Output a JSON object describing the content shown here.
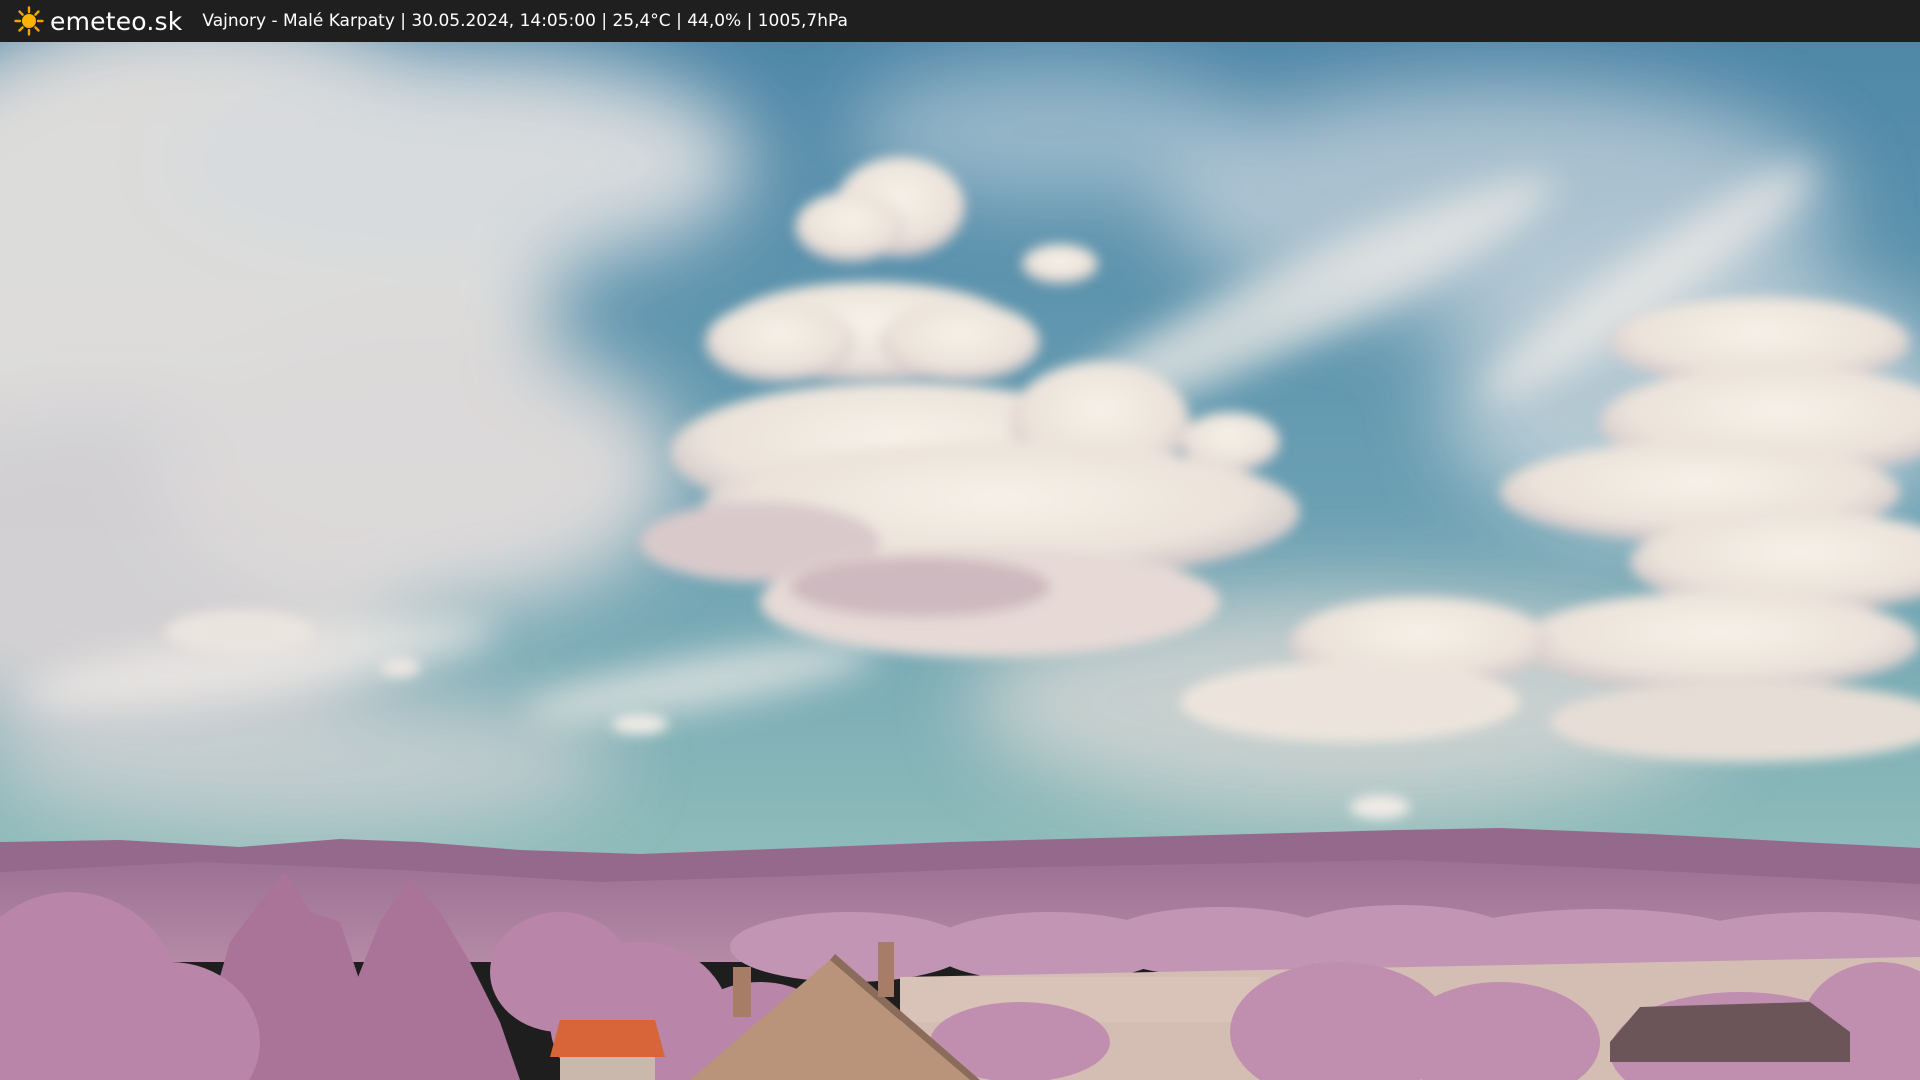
{
  "header": {
    "brand": "emeteo.sk",
    "caption": "Vajnory - Malé Karpaty | 30.05.2024, 14:05:00 | 25,4°C | 44,0% | 1005,7hPa",
    "logo_icon": "sun-icon",
    "logo_color": "#f5a300"
  },
  "image": {
    "subject": "webcam-landscape",
    "colors": {
      "sky_top": "#5a8fae",
      "sky_bottom": "#7fb0b5",
      "cloud": "#f1ece3",
      "cloud_shadow": "#c9b8bf",
      "hills": "#9a6f8f",
      "trees": "#b683a6",
      "field": "#d6bfb6",
      "roof": "#d8653a",
      "roof_tiles": "#b9947a"
    }
  }
}
